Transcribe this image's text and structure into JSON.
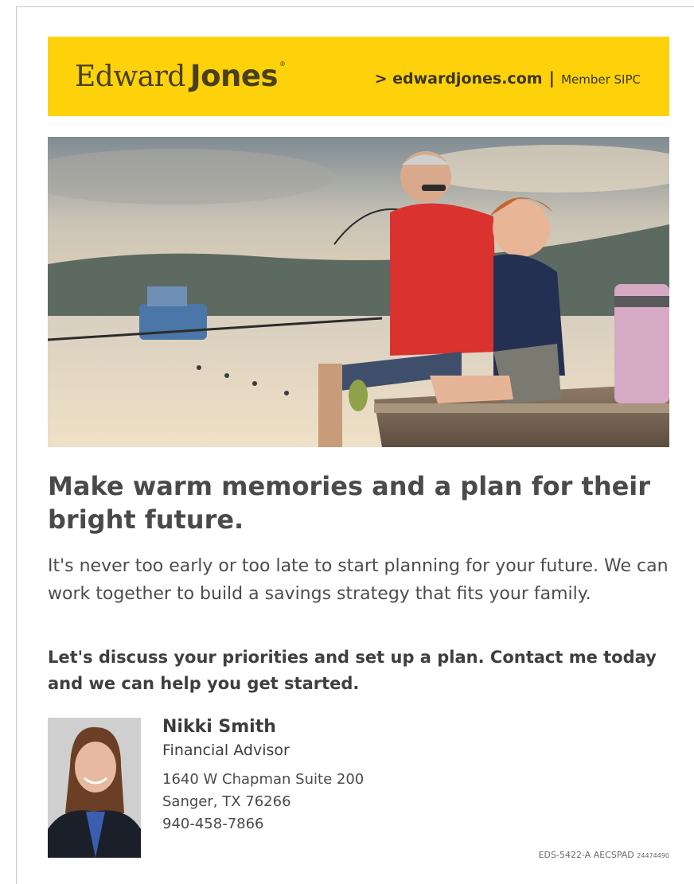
{
  "header": {
    "logo_first": "Edward",
    "logo_last": "Jones",
    "logo_reg": "®",
    "url": "> edwardjones.com",
    "separator": "|",
    "member": "Member SIPC",
    "banner_color": "#fdd20a"
  },
  "main": {
    "headline": "Make warm memories and a plan for their bright future.",
    "body": "It's never too early or too late to start planning for your future. We can work together to build a savings strategy that fits your family.",
    "cta": "Let's discuss your priorities and set up a plan. Contact me today and we can help you get started."
  },
  "advisor": {
    "name": "Nikki Smith",
    "title": "Financial Advisor",
    "address_line1": "1640 W Chapman Suite 200",
    "address_line2": "Sanger, TX 76266",
    "phone": "940-458-7866"
  },
  "footer": {
    "code": "EDS-5422-A AECSPAD",
    "code_small": "24474490"
  }
}
